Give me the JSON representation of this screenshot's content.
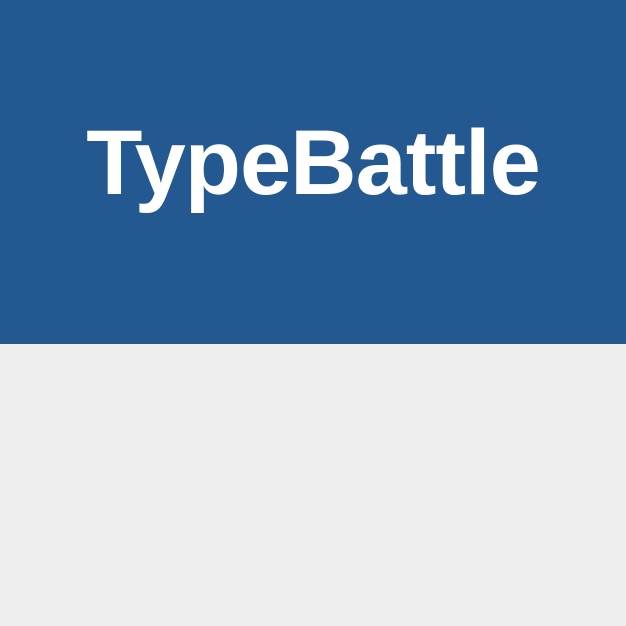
{
  "app": {
    "title": "TypeBattle"
  },
  "colors": {
    "header_background": "#245891",
    "title_text": "#ffffff",
    "page_background": "#eeeeee"
  }
}
